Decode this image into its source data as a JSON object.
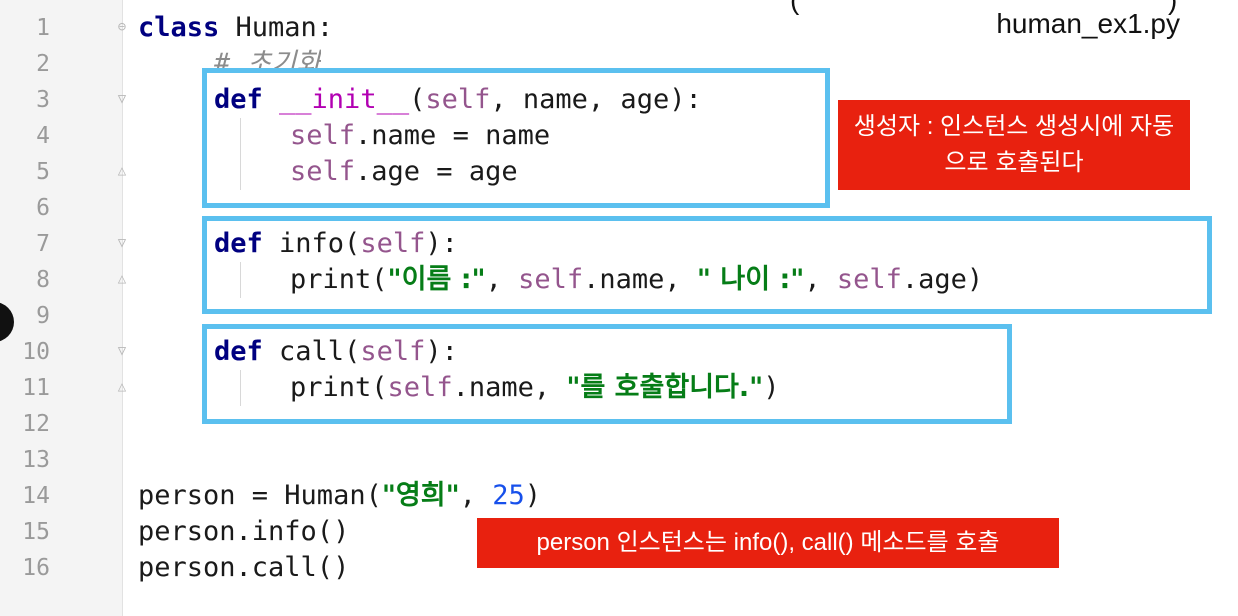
{
  "file_name": "human_ex1.py",
  "top_fragment_left": "(",
  "top_fragment_right": ")",
  "line_numbers": [
    "1",
    "2",
    "3",
    "4",
    "5",
    "6",
    "7",
    "8",
    "9",
    "10",
    "11",
    "12",
    "13",
    "14",
    "15",
    "16"
  ],
  "code": {
    "l1_kw": "class",
    "l1_rest": " Human:",
    "l2_comment": "# 초기화",
    "l3_kw": "def",
    "l3_name": " __init__",
    "l3_open": "(",
    "l3_self": "self",
    "l3_rest": ", name, age):",
    "l4_self": "self",
    "l4_rest": ".name = name",
    "l5_self": "self",
    "l5_rest": ".age = age",
    "l7_kw": "def",
    "l7_rest": " info(",
    "l7_self": "self",
    "l7_close": "):",
    "l8_a": "print(",
    "l8_str1": "\"이름 :\"",
    "l8_b": ", ",
    "l8_self1": "self",
    "l8_c": ".name, ",
    "l8_str2": "\" 나이 :\"",
    "l8_d": ", ",
    "l8_self2": "self",
    "l8_e": ".age)",
    "l10_kw": "def",
    "l10_rest": " call(",
    "l10_self": "self",
    "l10_close": "):",
    "l11_a": "print(",
    "l11_self": "self",
    "l11_b": ".name, ",
    "l11_str": "\"를 호출합니다.\"",
    "l11_c": ")",
    "l14_a": "person = Human(",
    "l14_str": "\"영희\"",
    "l14_b": ", ",
    "l14_num": "25",
    "l14_c": ")",
    "l15": "person.info()",
    "l16": "person.call()"
  },
  "annotations": {
    "constructor_note": "생성자 : 인스턴스 생성시에 자동으로 호출된다",
    "instance_note": "person 인스턴스는 info(), call() 메소드를 호출"
  },
  "colors": {
    "highlight_box": "#5bc0ef",
    "note_bg": "#e8210f",
    "keyword": "#000080",
    "self": "#94558d",
    "string": "#067d17",
    "number": "#1750eb"
  }
}
